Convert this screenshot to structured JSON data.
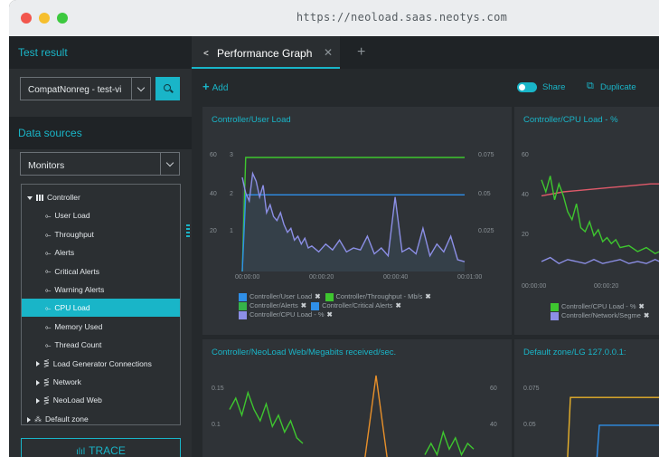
{
  "browser": {
    "url": "https://neoload.saas.neotys.com"
  },
  "sidebar": {
    "test_result_header": "Test result",
    "test_result_value": "CompatNonreg - test-vi",
    "data_sources_header": "Data sources",
    "source_select_value": "Monitors",
    "tree": [
      {
        "label": "Controller",
        "level": 0,
        "expanded": true,
        "icon": "grid-icon"
      },
      {
        "label": "User Load",
        "level": 1
      },
      {
        "label": "Throughput",
        "level": 1
      },
      {
        "label": "Alerts",
        "level": 1
      },
      {
        "label": "Critical Alerts",
        "level": 1
      },
      {
        "label": "Warning Alerts",
        "level": 1
      },
      {
        "label": "CPU Load",
        "level": 1,
        "selected": true
      },
      {
        "label": "Memory Used",
        "level": 1
      },
      {
        "label": "Thread Count",
        "level": 1
      },
      {
        "label": "Load Generator Connections",
        "level": 1,
        "expanded": false,
        "icon": "monitor-icon"
      },
      {
        "label": "Network",
        "level": 1,
        "expanded": false,
        "icon": "monitor-icon"
      },
      {
        "label": "NeoLoad Web",
        "level": 1,
        "expanded": false,
        "icon": "monitor-icon"
      },
      {
        "label": "Default zone",
        "level": 0,
        "expanded": false,
        "icon": "zone-icon"
      }
    ],
    "trace_label": "TRACE"
  },
  "main": {
    "tab_label": "Performance Graph",
    "add_label": "Add",
    "share_label": "Share",
    "duplicate_label": "Duplicate",
    "accent_color": "#19b5c8"
  },
  "panels": [
    {
      "title": "Controller/User Load",
      "legend": [
        [
          {
            "name": "Controller/User Load",
            "color": "#2f8fe8"
          },
          {
            "name": "Controller/Throughput - Mb/s",
            "color": "#3ec62f"
          }
        ],
        [
          {
            "name": "Controller/Alerts",
            "color": "#36b34a"
          },
          {
            "name": "Controller/Critical Alerts",
            "color": "#2f8fe8"
          }
        ],
        [
          {
            "name": "Controller/CPU Load - %",
            "color": "#8c8fe6"
          }
        ]
      ]
    },
    {
      "title": "Controller/CPU Load - %",
      "legend": [
        [
          {
            "name": "Controller/CPU Load - %",
            "color": "#3ec62f"
          }
        ],
        [
          {
            "name": "Controller/Network/Segme",
            "color": "#8c8fe6"
          }
        ]
      ]
    },
    {
      "title": "Controller/NeoLoad Web/Megabits received/sec."
    },
    {
      "title": "Default zone/LG 127.0.0.1:"
    }
  ],
  "chart_data": [
    {
      "type": "line",
      "title": "Controller/User Load",
      "x_ticks": [
        "00:00:00",
        "00:00:20",
        "00:00:40",
        "00:01:00"
      ],
      "y_left_ticks": [
        "60",
        "40",
        "20"
      ],
      "y_left2_ticks": [
        "3",
        "2",
        "1"
      ],
      "y_right_ticks": [
        "0.075",
        "0.05",
        "0.025"
      ],
      "series": [
        {
          "name": "Controller/Throughput - Mb/s",
          "color": "#3ec62f",
          "x": [
            0,
            1,
            2,
            3,
            64
          ],
          "values": [
            0,
            0.075,
            0.075,
            0.075,
            0.075
          ]
        },
        {
          "name": "Controller/User Load",
          "color": "#2f8fe8",
          "x": [
            0,
            1,
            64
          ],
          "values": [
            0,
            2,
            2
          ]
        },
        {
          "name": "Controller/CPU Load - %",
          "color": "#8c8fe6",
          "x": [
            0,
            1,
            2,
            3,
            4,
            5,
            6,
            7,
            8,
            9,
            10,
            11,
            12,
            13,
            14,
            15,
            16,
            17,
            18,
            19,
            20,
            22,
            24,
            26,
            28,
            30,
            32,
            34,
            36,
            38,
            40,
            42,
            44,
            46,
            48,
            50,
            52,
            54,
            56,
            58,
            60,
            62,
            64
          ],
          "values": [
            48,
            40,
            36,
            50,
            46,
            38,
            44,
            30,
            34,
            28,
            26,
            30,
            24,
            20,
            22,
            16,
            18,
            14,
            17,
            12,
            13,
            10,
            14,
            11,
            16,
            10,
            12,
            11,
            18,
            9,
            12,
            8,
            38,
            10,
            12,
            9,
            22,
            8,
            14,
            10,
            18,
            6,
            5
          ]
        }
      ]
    },
    {
      "type": "line",
      "title": "Controller/CPU Load - %",
      "x_ticks": [
        "00:00:00",
        "00:00:20"
      ],
      "y_ticks": [
        "60",
        "40",
        "20"
      ],
      "series": [
        {
          "name": "Controller/CPU Load - %",
          "color": "#3ec62f",
          "x": [
            0,
            1,
            2,
            3,
            4,
            5,
            6,
            7,
            8,
            9,
            10,
            11,
            12,
            13,
            14,
            15,
            16,
            17,
            18,
            20,
            22,
            24,
            26,
            28,
            30
          ],
          "values": [
            46,
            40,
            48,
            36,
            44,
            38,
            30,
            26,
            34,
            22,
            20,
            25,
            18,
            21,
            15,
            17,
            14,
            16,
            12,
            13,
            10,
            12,
            9,
            11,
            8
          ]
        },
        {
          "name": "Controller/Network/Segme",
          "color": "#8c8fe6",
          "x": [
            0,
            2,
            4,
            6,
            8,
            10,
            12,
            14,
            16,
            18,
            20,
            22,
            24,
            26,
            28,
            30
          ],
          "values": [
            5,
            7,
            4,
            6,
            5,
            4,
            6,
            4,
            5,
            6,
            4,
            5,
            4,
            6,
            4,
            5
          ]
        },
        {
          "name": "",
          "color": "#e05a6a",
          "x": [
            0,
            5,
            10,
            15,
            20,
            25,
            30
          ],
          "values": [
            38,
            40,
            41,
            42,
            43,
            44,
            44
          ]
        }
      ]
    },
    {
      "type": "line",
      "title": "Controller/NeoLoad Web/Megabits received/sec.",
      "y_left_ticks": [
        "0.15",
        "0.1"
      ],
      "y_right_ticks": [
        "60",
        "40"
      ],
      "series": [
        {
          "name": "",
          "color": "#3ec62f",
          "x": [
            0,
            1,
            2,
            3,
            4,
            5,
            6,
            7,
            8,
            9,
            10,
            11,
            12
          ],
          "values": [
            0.1,
            0.12,
            0.09,
            0.13,
            0.1,
            0.08,
            0.11,
            0.07,
            0.09,
            0.06,
            0.08,
            0.05,
            0.04
          ]
        },
        {
          "name": "",
          "color": "#e8902a",
          "x": [
            0,
            20,
            22,
            24,
            26,
            28,
            30
          ],
          "values": [
            0,
            0,
            0,
            0.16,
            0,
            0,
            0
          ]
        },
        {
          "name": "",
          "color": "#3ec62f",
          "x": [
            32,
            33,
            34,
            35,
            36,
            37,
            38,
            39,
            40
          ],
          "values": [
            0.02,
            0.04,
            0.02,
            0.06,
            0.03,
            0.05,
            0.02,
            0.04,
            0.03
          ]
        }
      ]
    },
    {
      "type": "line",
      "title": "Default zone/LG 127.0.0.1:",
      "y_ticks": [
        "0.075",
        "0.05"
      ],
      "series": [
        {
          "name": "",
          "color": "#e8b12a",
          "x": [
            0,
            2,
            3,
            30
          ],
          "values": [
            0,
            0,
            0.07,
            0.07
          ]
        },
        {
          "name": "",
          "color": "#2f8fe8",
          "x": [
            0,
            10,
            11,
            30
          ],
          "values": [
            0,
            0,
            0.045,
            0.045
          ]
        }
      ]
    }
  ]
}
